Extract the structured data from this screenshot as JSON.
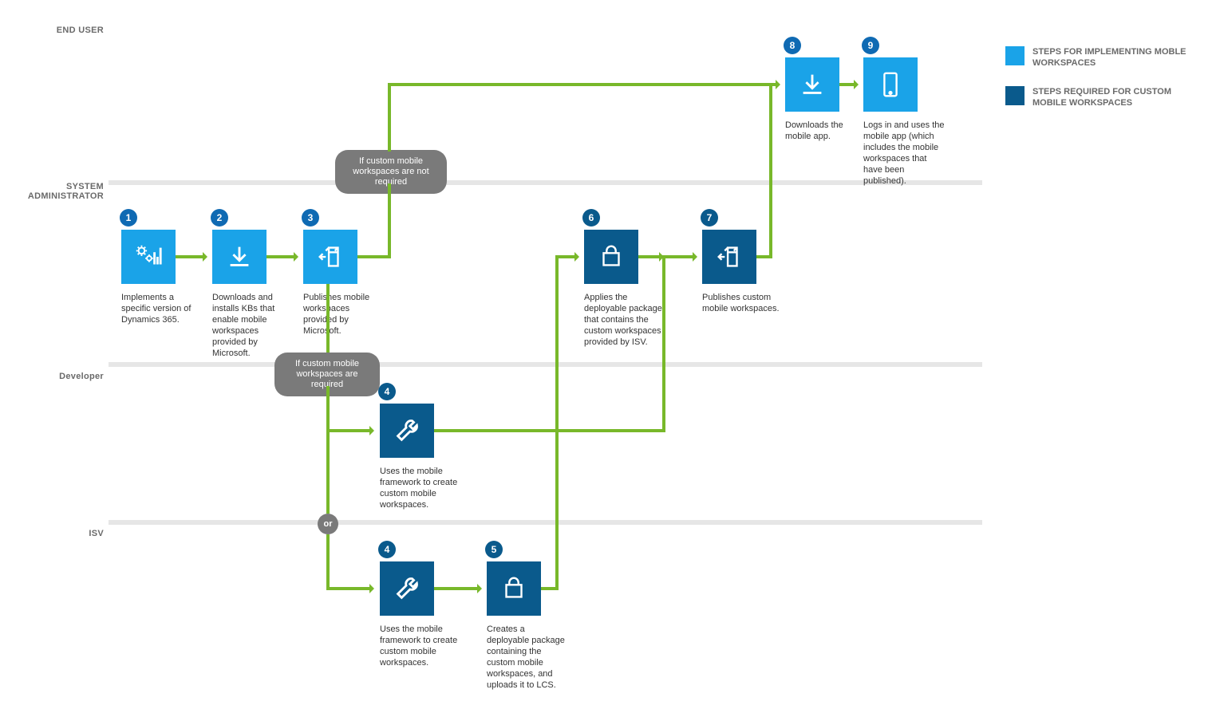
{
  "colors": {
    "implLight": "#1aa3e8",
    "customDark": "#0a5a8c",
    "flowGreen": "#78b82a"
  },
  "legend": {
    "impl": "STEPS FOR IMPLEMENTING MOBLE WORKSPACES",
    "custom": "STEPS REQUIRED FOR CUSTOM MOBILE WORKSPACES"
  },
  "lanes": {
    "endUser": "END USER",
    "sysAdmin": "SYSTEM ADMINISTRATOR",
    "developer": "Developer",
    "isv": "ISV"
  },
  "bubbles": {
    "notReq": "If custom mobile workspaces are not required",
    "req": "If custom mobile workspaces are required",
    "or": "or"
  },
  "steps": {
    "s1": {
      "num": "1",
      "text": "Implements a specific version of Dynamics 365."
    },
    "s2": {
      "num": "2",
      "text": "Downloads and installs KBs that enable mobile workspaces provided by Microsoft."
    },
    "s3": {
      "num": "3",
      "text": "Publishes mobile workspaces provided by Microsoft."
    },
    "s4a": {
      "num": "4",
      "text": "Uses the mobile framework to create custom mobile workspaces."
    },
    "s4b": {
      "num": "4",
      "text": "Uses the mobile framework to create custom mobile workspaces."
    },
    "s5": {
      "num": "5",
      "text": "Creates a deployable package containing the custom mobile workspaces, and uploads it to LCS."
    },
    "s6": {
      "num": "6",
      "text": "Applies the deployable package that contains the custom workspaces provided by ISV."
    },
    "s7": {
      "num": "7",
      "text": "Publishes custom mobile workspaces."
    },
    "s8": {
      "num": "8",
      "text": "Downloads the mobile app."
    },
    "s9": {
      "num": "9",
      "text": "Logs in and uses the mobile app (which includes the mobile workspaces that have been published)."
    }
  }
}
